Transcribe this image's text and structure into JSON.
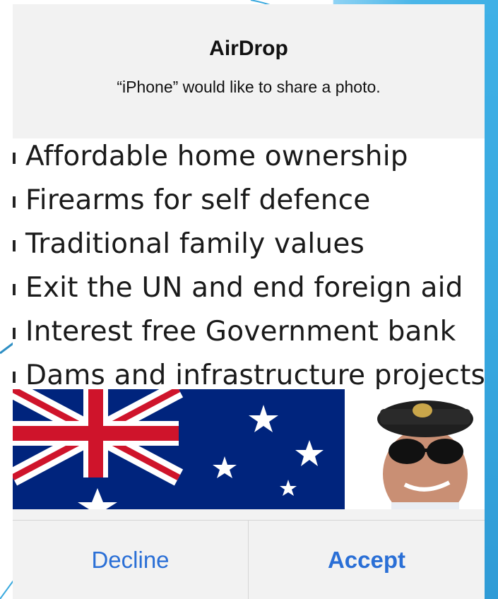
{
  "alert": {
    "title": "AirDrop",
    "message": "“iPhone” would like to share a photo."
  },
  "preview": {
    "bullets": [
      "Affordable home ownership",
      "Firearms for self defence",
      "Traditional family values",
      "Exit the UN and end foreign aid",
      "Interest free Government bank",
      "Dams and infrastructure projects"
    ]
  },
  "actions": {
    "decline_label": "Decline",
    "accept_label": "Accept"
  },
  "colors": {
    "button_text": "#2a6fd6",
    "sheet_background": "#f2f2f2",
    "backdrop": "#3fb0e6"
  }
}
